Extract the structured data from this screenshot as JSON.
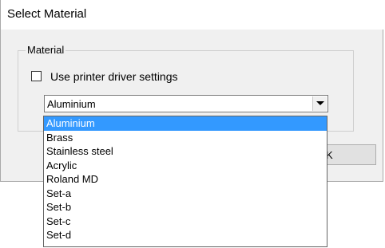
{
  "dialog": {
    "title": "Select Material",
    "group_label": "Material",
    "checkbox": {
      "label": "Use printer driver settings",
      "checked": false
    },
    "combo": {
      "selected_value": "Aluminium"
    },
    "ok_button_label": "K"
  },
  "dropdown": {
    "highlighted": "Aluminium",
    "items": [
      {
        "label": "Aluminium"
      },
      {
        "label": "Brass"
      },
      {
        "label": "Stainless steel"
      },
      {
        "label": "Acrylic"
      },
      {
        "label": "Roland MD"
      },
      {
        "label": "Set-a"
      },
      {
        "label": "Set-b"
      },
      {
        "label": "Set-c"
      },
      {
        "label": "Set-d"
      }
    ]
  },
  "colors": {
    "highlight": "#3399ff",
    "dialog_background": "#f0f0f0"
  }
}
